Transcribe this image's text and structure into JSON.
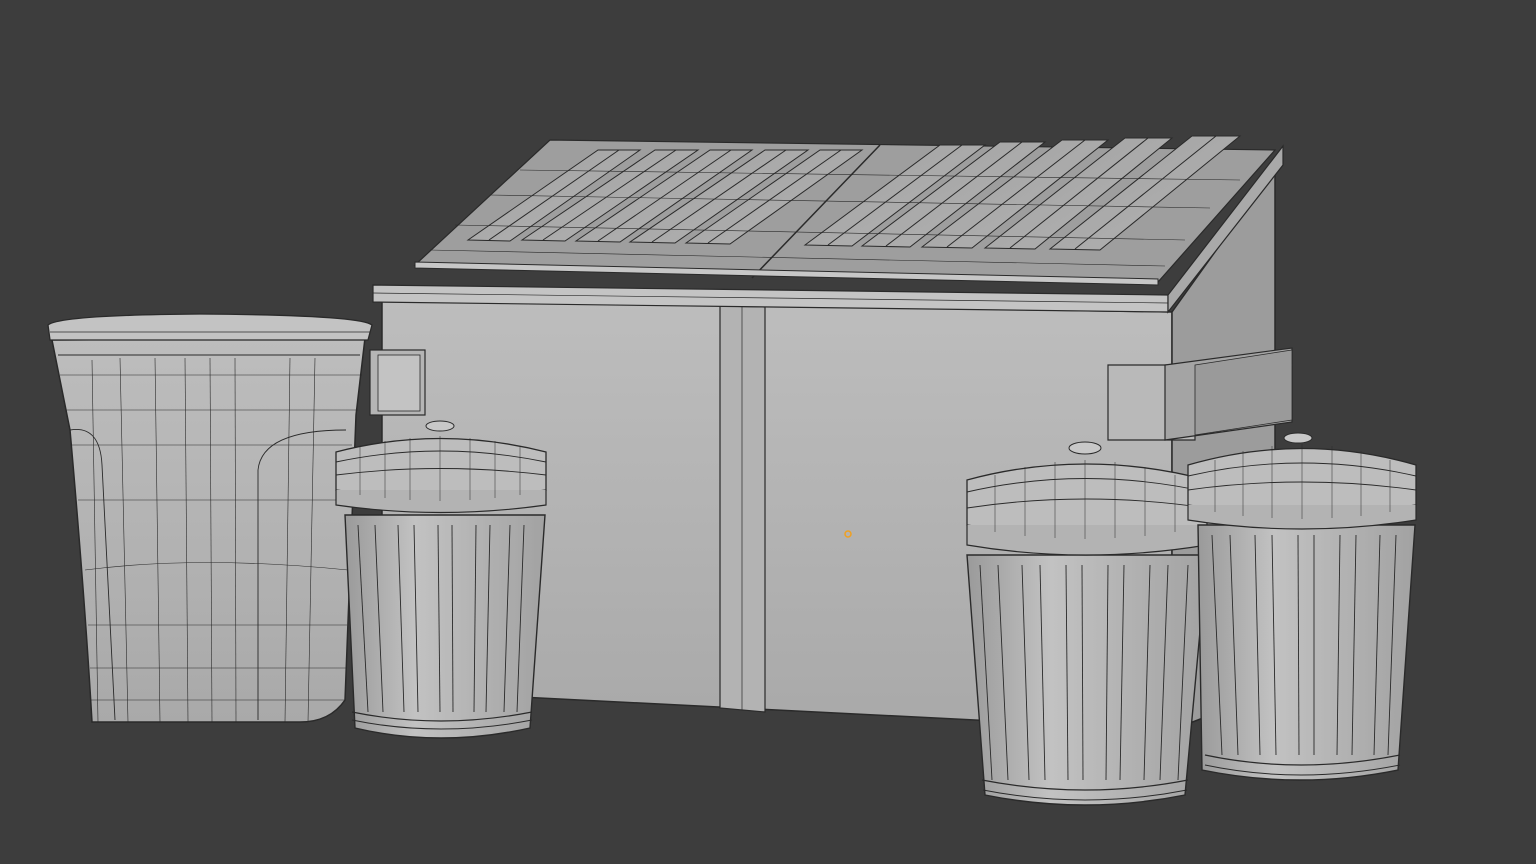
{
  "viewport": {
    "background": "#3d3d3d",
    "shading": "solid-wireframe",
    "origin_marker_color": "#f0a020"
  },
  "scene": {
    "objects": [
      {
        "name": "dumpster",
        "lid_panels": 2,
        "lid_ribs_per_panel": 5,
        "side_handles": 2
      },
      {
        "name": "rectangular-wastebin"
      },
      {
        "name": "metal-trash-can-left"
      },
      {
        "name": "metal-trash-can-center"
      },
      {
        "name": "metal-trash-can-right"
      }
    ]
  },
  "colors": {
    "surface_light": "#b9b9b9",
    "surface_mid": "#a6a6a6",
    "surface_dark": "#8d8d8d",
    "wire": "#2a2a2a"
  }
}
